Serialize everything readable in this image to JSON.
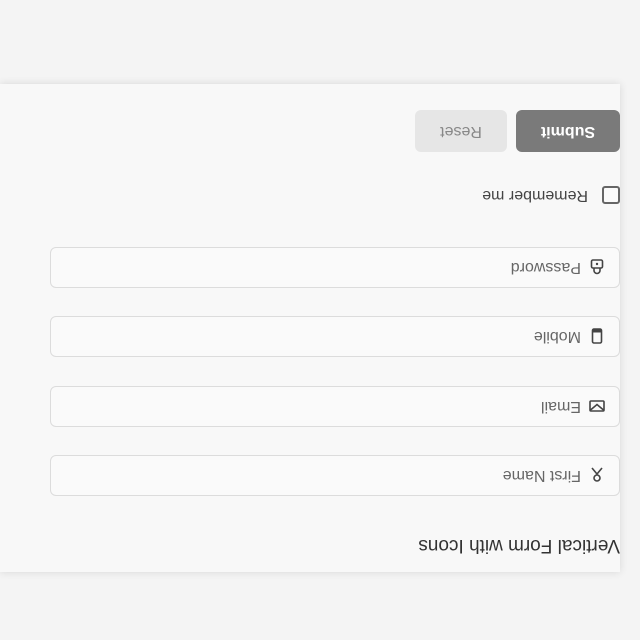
{
  "form": {
    "title": "Vertical Form with Icons",
    "fields": [
      {
        "placeholder": "First Name",
        "icon": "person-icon"
      },
      {
        "placeholder": "Email",
        "icon": "envelope-icon"
      },
      {
        "placeholder": "Mobile",
        "icon": "phone-icon"
      },
      {
        "placeholder": "Password",
        "icon": "lock-icon"
      }
    ],
    "remember_label": "Remember me",
    "remember_checked": false,
    "buttons": {
      "submit_label": "Submit",
      "reset_label": "Reset"
    }
  },
  "colors": {
    "primary_button": "#7a7a7a",
    "secondary_button": "#e6e6e6"
  }
}
